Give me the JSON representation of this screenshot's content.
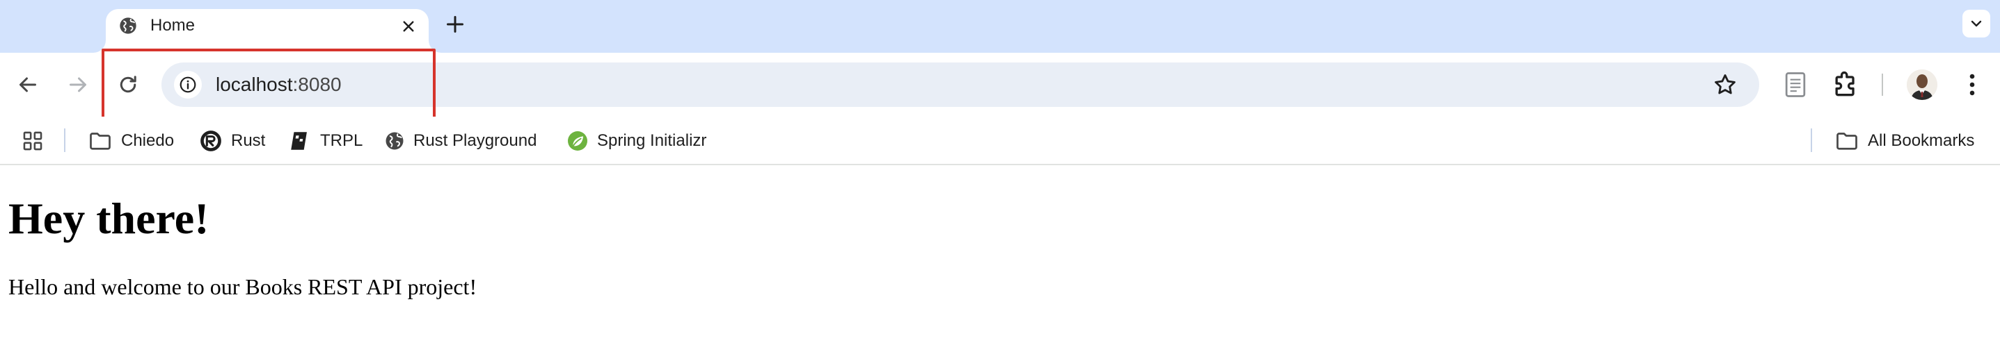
{
  "tabs": [
    {
      "title": "Home",
      "icon": "globe-icon",
      "active": true
    }
  ],
  "toolbar": {
    "url_host": "localhost",
    "url_port": ":8080"
  },
  "bookmarks": {
    "items": [
      {
        "label": "Chiedo",
        "icon": "folder-icon"
      },
      {
        "label": "Rust",
        "icon": "rust-logo-icon"
      },
      {
        "label": "TRPL",
        "icon": "book-icon"
      },
      {
        "label": "Rust Playground",
        "icon": "globe-icon"
      },
      {
        "label": "Spring Initializr",
        "icon": "spring-leaf-icon"
      }
    ],
    "all_bookmarks_label": "All Bookmarks"
  },
  "page": {
    "heading": "Hey there!",
    "paragraph": "Hello and welcome to our Books REST API project!"
  },
  "colors": {
    "tabstrip_bg": "#d3e3fd",
    "omnibox_bg": "#e9eef6",
    "highlight_border": "#d6342c",
    "spring_green": "#6db33f"
  }
}
